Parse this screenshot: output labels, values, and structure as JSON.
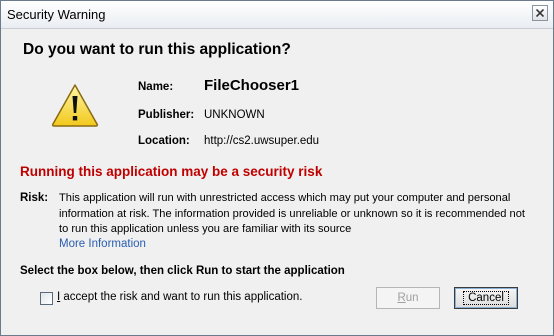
{
  "window": {
    "title": "Security Warning"
  },
  "dialog": {
    "heading": "Do you want to run this application?",
    "name_label": "Name:",
    "name_value": "FileChooser1",
    "publisher_label": "Publisher:",
    "publisher_value": "UNKNOWN",
    "location_label": "Location:",
    "location_value": "http://cs2.uwsuper.edu",
    "risk_heading": "Running this application may be a security risk",
    "risk_label": "Risk:",
    "risk_text": "This application will run with unrestricted access which may put your computer and personal information at risk. The information provided is unreliable or unknown so it is recommended not to run this application unless you are familiar with its source",
    "more_info": "More Information",
    "instruction": "Select the box below, then click Run to start the application",
    "checkbox_label_prefix": "I",
    "checkbox_label_rest": " accept the risk and want to run this application.",
    "checkbox_checked": false
  },
  "buttons": {
    "run_prefix": "R",
    "run_rest": "un",
    "run_enabled": false,
    "cancel": "Cancel"
  },
  "icons": {
    "warning": "warning-triangle-icon",
    "close": "close-icon"
  },
  "colors": {
    "risk_heading": "#c00000",
    "link": "#2a5db0",
    "warning_fill": "#f7d94c"
  }
}
